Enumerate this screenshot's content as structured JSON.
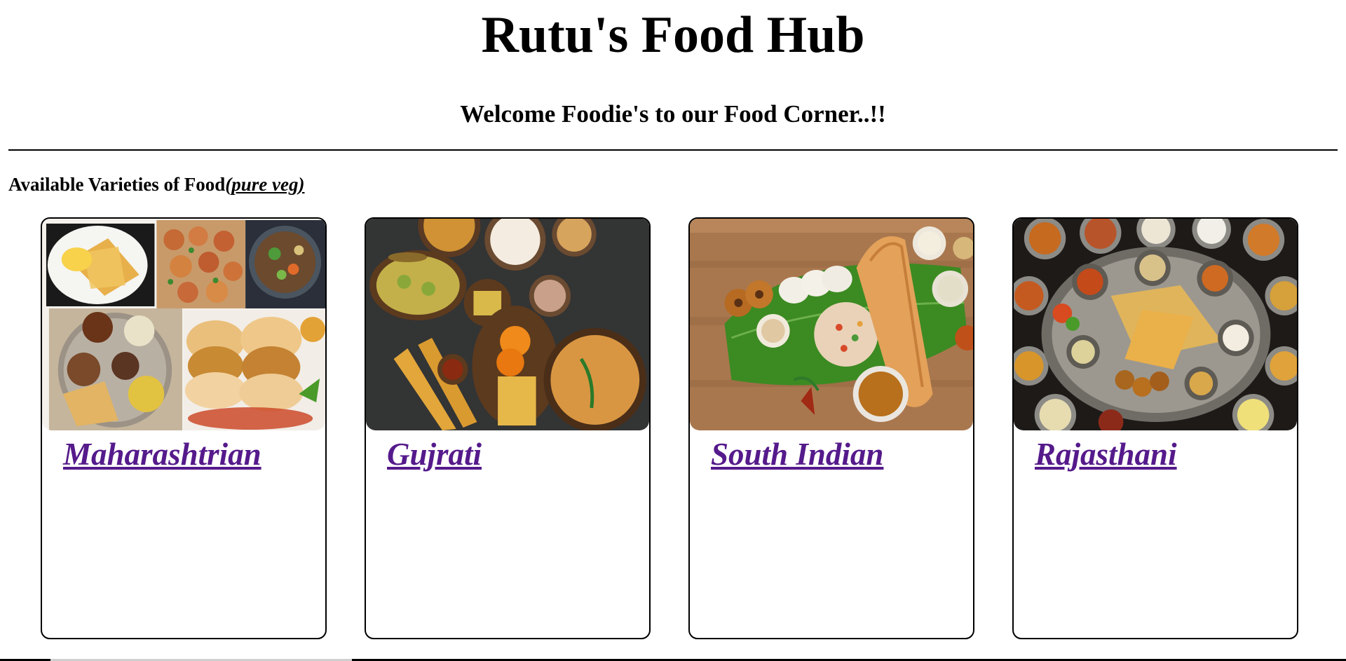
{
  "header": {
    "title": "Rutu's Food Hub",
    "welcome": "Welcome Foodie's to our Food Corner..!!"
  },
  "section": {
    "heading": "Available Varieties of Food",
    "subheading": "(pure veg)"
  },
  "cards": [
    {
      "label": "Maharashtrian",
      "image": "collage of paratha, shrimp curry, salad bowl, thali and vada pav",
      "link_color": "#551a8b"
    },
    {
      "label": "Gujrati",
      "image": "dhokla, khandvi, jalebi, fafda and khakhra on dark slate",
      "link_color": "#551a8b"
    },
    {
      "label": "South Indian",
      "image": "idli, vada, uttapam, dosa, sambar and chutneys on banana leaf",
      "link_color": "#551a8b"
    },
    {
      "label": "Rajasthani",
      "image": "large rajasthani thali with many small bowls",
      "link_color": "#551a8b"
    }
  ]
}
